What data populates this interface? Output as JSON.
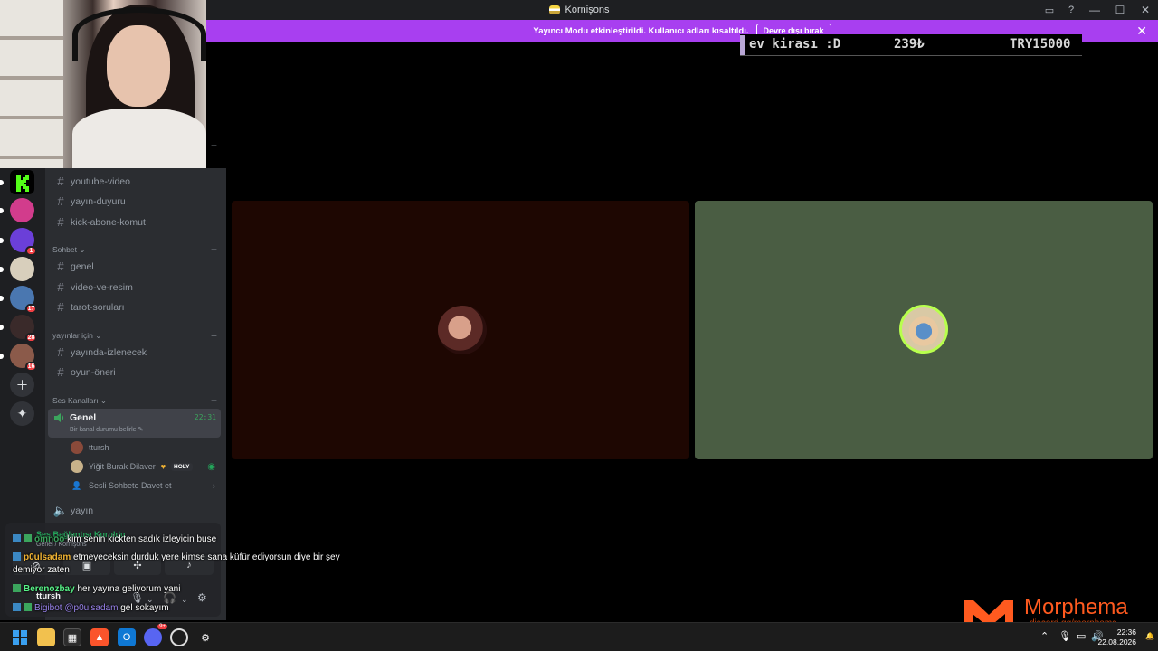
{
  "window": {
    "title": "Kornişons"
  },
  "notice": {
    "text": "Yayıncı Modu etkinleştirildi. Kullanıcı adları kısaltıldı.",
    "button": "Devre dışı bırak"
  },
  "ticker": {
    "item1": "ev kirası :D",
    "item2": "239₺",
    "item3": "TRY15000"
  },
  "servers": [
    {
      "badge": ""
    },
    {
      "badge": ""
    },
    {
      "badge": "1"
    },
    {
      "badge": ""
    },
    {
      "badge": "17"
    },
    {
      "badge": "28"
    },
    {
      "badge": "16"
    }
  ],
  "sidebar": {
    "channels_top": [
      "youtube-video",
      "yayın-duyuru",
      "kick-abone-komut"
    ],
    "cat_sohbet": "Sohbet",
    "sohbet_channels": [
      "genel",
      "video-ve-resim",
      "tarot-soruları"
    ],
    "cat_yayinlar": "yayınlar için",
    "yayinlar_channels": [
      "yayında-izlenecek",
      "oyun-öneri"
    ],
    "cat_ses": "Ses Kanalları",
    "voice_channel": {
      "name": "Genel",
      "time": "22:31",
      "status": "Bir kanal durumu belirle"
    },
    "voice_users": [
      "ttursh",
      "Yiğit Burak Dilaver"
    ],
    "voice_user_badge": "HOLY",
    "invite_label": "Sesli Sohbete Davet et",
    "voice_channel2": "yayın"
  },
  "voice_panel": {
    "title": "Ses Bağlantısı Kuruldu",
    "subtitle": "Genel / Kornişons",
    "user": "ttursh"
  },
  "chat": [
    {
      "user": "omnoo",
      "text": "kim senin kickten sadık izleyicin buse"
    },
    {
      "user": "p0ulsadam",
      "text": "etmeyeceksin durduk yere kimse sana küfür ediyorsun diye bir şey"
    },
    {
      "user": "",
      "text": "demiyor zaten"
    },
    {
      "user": "Berenozbay",
      "text": "her yayına geliyorum yani"
    },
    {
      "user": "Bigibot",
      "mention": "@p0ulsadam",
      "text": "gel sokayım"
    }
  ],
  "watermark": {
    "brand": "Morphema",
    "url": "discord.gg/morphema"
  },
  "taskbar": {
    "time": "22:36",
    "date": "22.08.2026",
    "discord_badge": "9+"
  },
  "colors": {
    "notice": "#a83ff0",
    "tile_left": "#1e0702",
    "tile_right": "#4a5d43",
    "accent_green": "#23a55a"
  }
}
